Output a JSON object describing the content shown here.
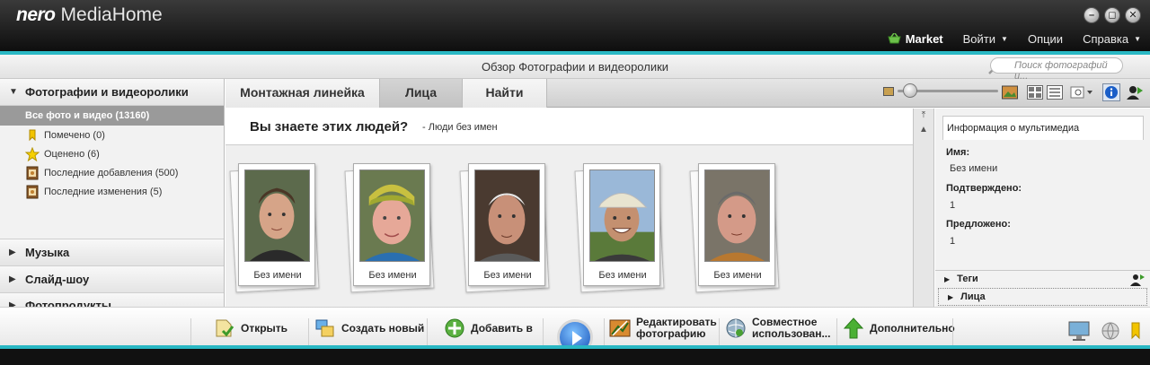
{
  "app": {
    "brand": "nero",
    "name": "MediaHome"
  },
  "window_buttons": [
    "–",
    "◻",
    "✕"
  ],
  "menu": {
    "market": "Market",
    "items": [
      {
        "label": "Войти",
        "dropdown": true
      },
      {
        "label": "Опции",
        "dropdown": false
      },
      {
        "label": "Справка",
        "dropdown": true
      }
    ]
  },
  "header": {
    "title": "Обзор Фотографии и видеоролики",
    "search_placeholder": "Поиск фотографий и..."
  },
  "sidebar": {
    "section_title": "Фотографии и видеоролики",
    "all_label": "Все фото и видео (13160)",
    "items": [
      {
        "label": "Помечено (0)",
        "icon": "tag-icon"
      },
      {
        "label": "Оценено (6)",
        "icon": "star-icon"
      },
      {
        "label": "Последние добавления (500)",
        "icon": "album-icon"
      },
      {
        "label": "Последние изменения (5)",
        "icon": "album-icon"
      }
    ],
    "collapsed_sections": [
      "Музыка",
      "Слайд-шоу",
      "Фотопродукты"
    ]
  },
  "tabs": {
    "timeline": "Монтажная линейка",
    "faces": "Лица",
    "find": "Найти",
    "active": "faces"
  },
  "faces": {
    "question": "Вы знаете этих людей?",
    "subtitle": "- Люди без имен",
    "cards": [
      {
        "name": "Без имени"
      },
      {
        "name": "Без имени"
      },
      {
        "name": "Без имени"
      },
      {
        "name": "Без имени"
      },
      {
        "name": "Без имени"
      }
    ]
  },
  "info": {
    "tab": "Информация о мультимедиа",
    "name_label": "Имя:",
    "name_value": "Без имени",
    "confirmed_label": "Подтверждено:",
    "confirmed_value": "1",
    "suggested_label": "Предложено:",
    "suggested_value": "1",
    "accordion": [
      "Теги",
      "Лица"
    ]
  },
  "toolbar": {
    "open": "Открыть",
    "create": "Создать новый",
    "add": "Добавить в",
    "edit_line1": "Редактировать",
    "edit_line2": "фотографию",
    "share_line1": "Совместное",
    "share_line2": "использован...",
    "more": "Дополнительно"
  },
  "colors": {
    "accent": "#2ab8c4",
    "titlebar": "#1a1a1a",
    "active_tab": "#c8c8c8"
  }
}
